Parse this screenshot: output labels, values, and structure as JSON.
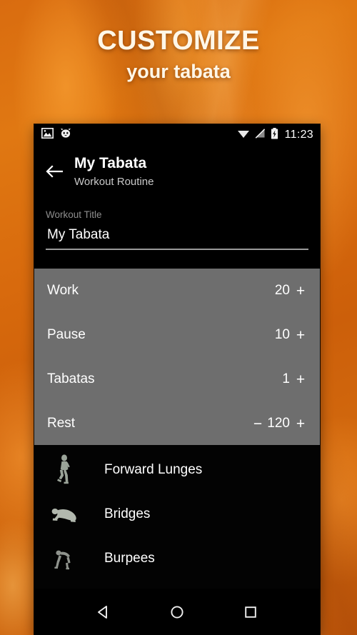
{
  "promo": {
    "line1": "CUSTOMIZE",
    "line2": "your tabata",
    "background_color": "#d96c10",
    "text_color": "#fff7e8"
  },
  "statusbar": {
    "icons_left": [
      "image-icon",
      "cat-face-icon"
    ],
    "icons_right": [
      "wifi-icon",
      "signal-off-icon",
      "battery-charging-icon"
    ],
    "clock": "11:23"
  },
  "appbar": {
    "back_icon": "back-arrow-icon",
    "title": "My Tabata",
    "subtitle": "Workout Routine"
  },
  "title_field": {
    "label": "Workout Title",
    "value": "My Tabata",
    "placeholder": "Workout Title"
  },
  "settings": {
    "panel_color": "#6e6e6e",
    "rows": [
      {
        "label": "Work",
        "value": "20",
        "minus": "",
        "plus": "+"
      },
      {
        "label": "Pause",
        "value": "10",
        "minus": "",
        "plus": "+"
      },
      {
        "label": "Tabatas",
        "value": "1",
        "minus": "",
        "plus": "+"
      },
      {
        "label": "Rest",
        "value": "120",
        "minus": "−",
        "plus": "+"
      }
    ]
  },
  "exercises": {
    "items": [
      {
        "name": "Forward Lunges",
        "icon": "lunge-figure-icon"
      },
      {
        "name": "Bridges",
        "icon": "bridge-figure-icon"
      },
      {
        "name": "Burpees",
        "icon": "burpee-figure-icon"
      }
    ]
  },
  "navbar": {
    "back": "nav-back-icon",
    "home": "nav-home-icon",
    "recents": "nav-recents-icon"
  }
}
